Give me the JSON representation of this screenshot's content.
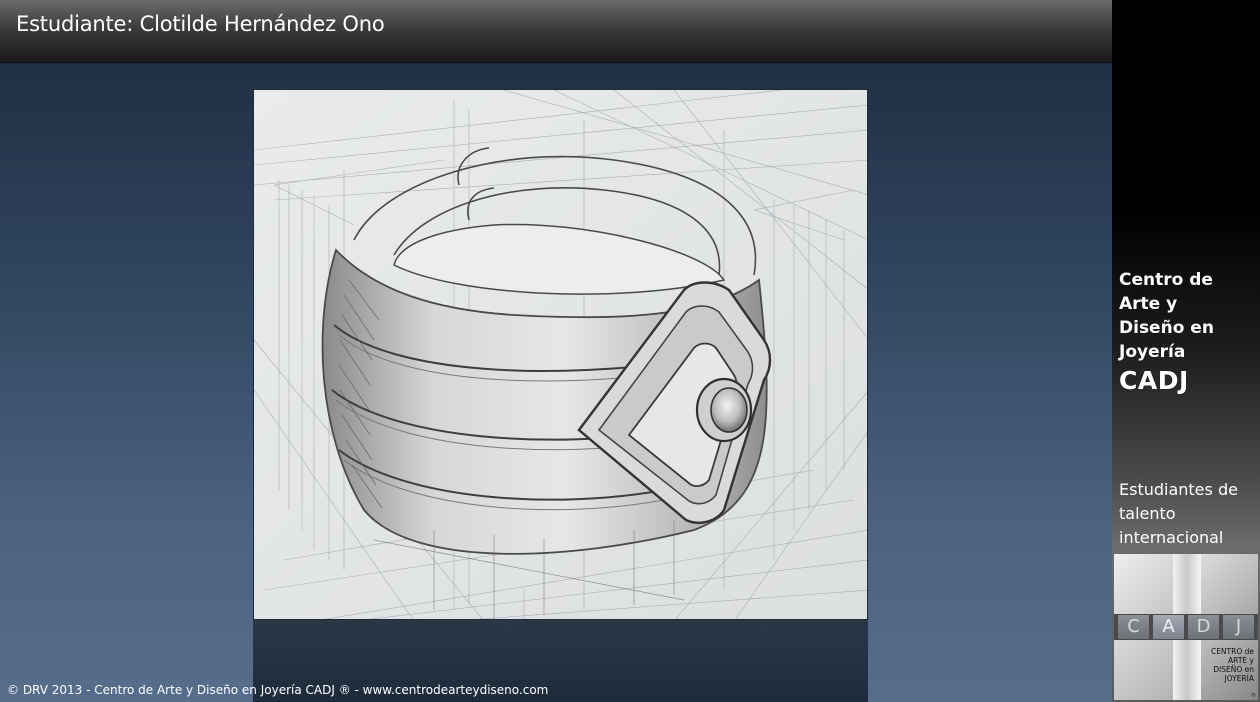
{
  "header": {
    "title": "Estudiante: Clotilde Hernández Ono"
  },
  "footer": {
    "credit": "© DRV 2013 - Centro de Arte y Diseño en Joyería CADJ ® - www.centrodearteydiseno.com"
  },
  "sidebar": {
    "school_name_lines": [
      "Centro de",
      "Arte y",
      "Diseño en",
      "Joyería"
    ],
    "school_abbr": "CADJ",
    "tagline_lines": [
      "Estudiantes de",
      "talento",
      "internacional"
    ]
  },
  "logo": {
    "letters": [
      "C",
      "A",
      "D",
      "J"
    ],
    "small_lines": [
      "CENTRO de",
      "ARTE y",
      "DISEÑO en",
      "JOYERÍA"
    ],
    "registered": "®"
  },
  "artwork": {
    "subject": "pencil-sketch-ring-icon"
  },
  "colors": {
    "title_bar_top": "#6b6b6b",
    "title_bar_bottom": "#1a1a1a",
    "stage_top": "#1b2a3d",
    "stage_bottom": "#566d8c",
    "paper": "#e3e5e6",
    "pencil": "#4a4a4a"
  }
}
